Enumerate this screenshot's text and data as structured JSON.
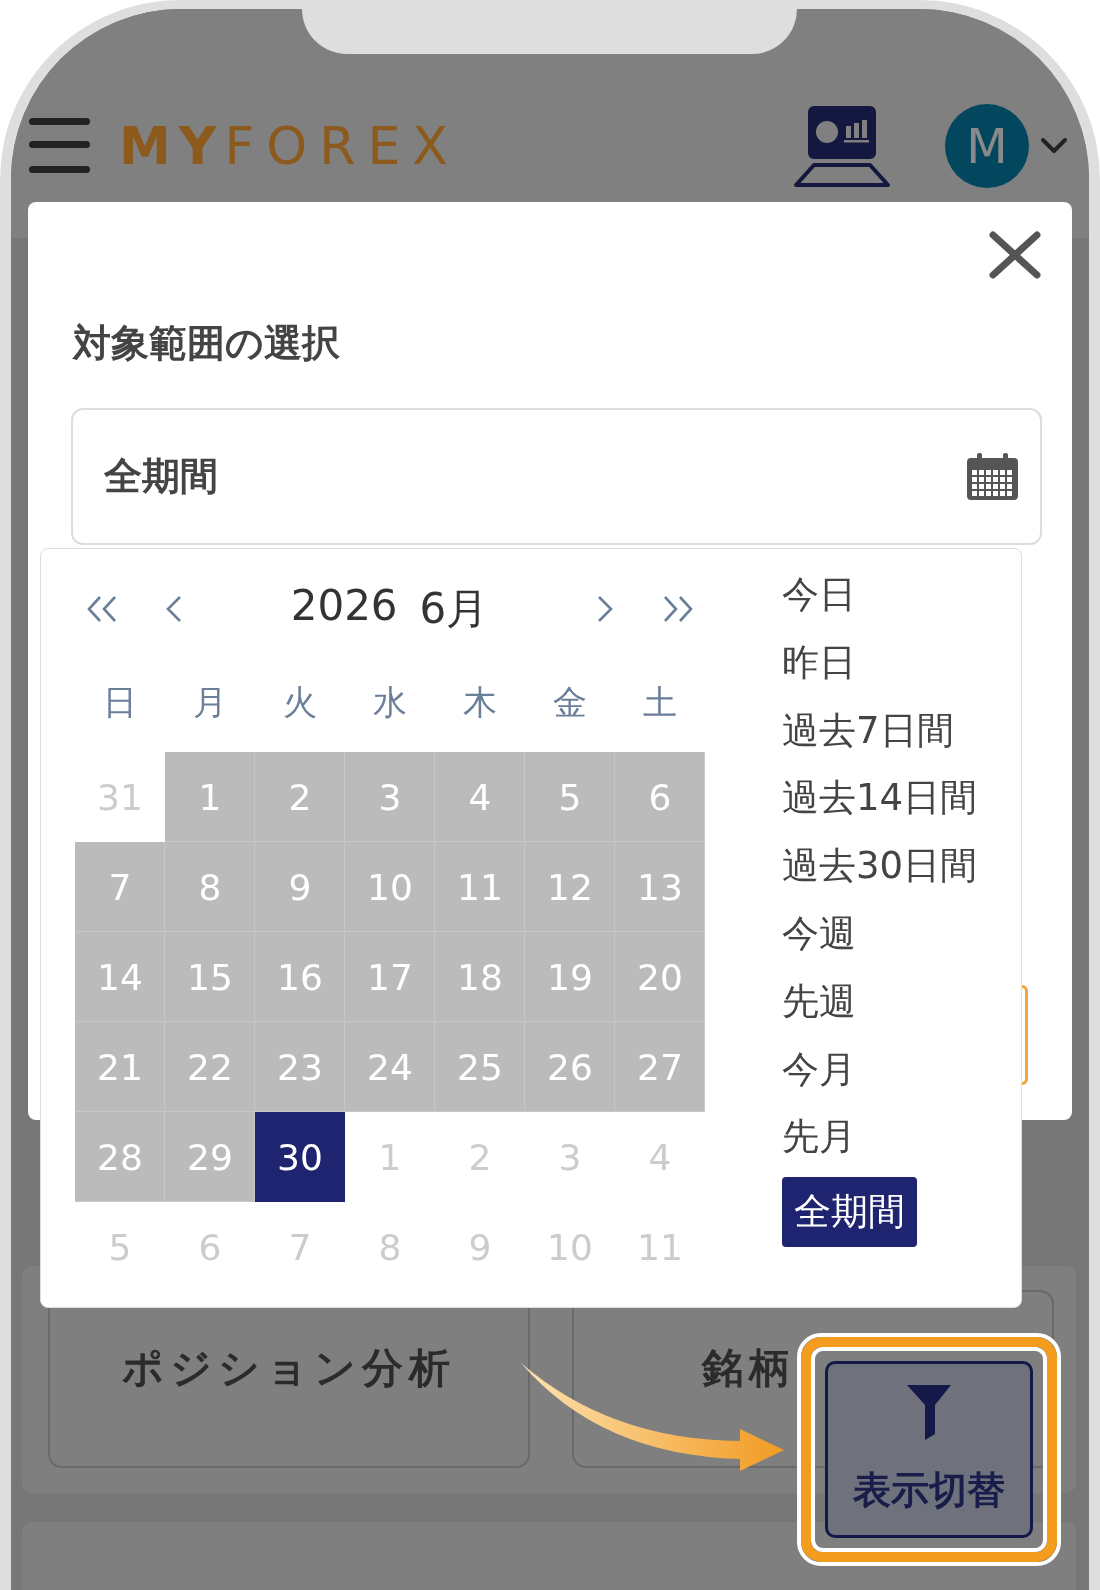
{
  "header": {
    "logo": "**MY**FOREX",
    "avatar_initial": "M"
  },
  "modal": {
    "title": "対象範囲の選択",
    "field": {
      "value": "全期間"
    }
  },
  "calendar": {
    "year": "2026",
    "month": "6月",
    "weekdays": [
      "日",
      "月",
      "火",
      "水",
      "木",
      "金",
      "土"
    ],
    "weeks": [
      [
        {
          "label": "31",
          "muted": true,
          "in_range": false,
          "selected": false
        },
        {
          "label": "1",
          "muted": false,
          "in_range": true,
          "selected": false
        },
        {
          "label": "2",
          "muted": false,
          "in_range": true,
          "selected": false
        },
        {
          "label": "3",
          "muted": false,
          "in_range": true,
          "selected": false
        },
        {
          "label": "4",
          "muted": false,
          "in_range": true,
          "selected": false
        },
        {
          "label": "5",
          "muted": false,
          "in_range": true,
          "selected": false
        },
        {
          "label": "6",
          "muted": false,
          "in_range": true,
          "selected": false
        }
      ],
      [
        {
          "label": "7",
          "muted": false,
          "in_range": true,
          "selected": false
        },
        {
          "label": "8",
          "muted": false,
          "in_range": true,
          "selected": false
        },
        {
          "label": "9",
          "muted": false,
          "in_range": true,
          "selected": false
        },
        {
          "label": "10",
          "muted": false,
          "in_range": true,
          "selected": false
        },
        {
          "label": "11",
          "muted": false,
          "in_range": true,
          "selected": false
        },
        {
          "label": "12",
          "muted": false,
          "in_range": true,
          "selected": false
        },
        {
          "label": "13",
          "muted": false,
          "in_range": true,
          "selected": false
        }
      ],
      [
        {
          "label": "14",
          "muted": false,
          "in_range": true,
          "selected": false
        },
        {
          "label": "15",
          "muted": false,
          "in_range": true,
          "selected": false
        },
        {
          "label": "16",
          "muted": false,
          "in_range": true,
          "selected": false
        },
        {
          "label": "17",
          "muted": false,
          "in_range": true,
          "selected": false
        },
        {
          "label": "18",
          "muted": false,
          "in_range": true,
          "selected": false
        },
        {
          "label": "19",
          "muted": false,
          "in_range": true,
          "selected": false
        },
        {
          "label": "20",
          "muted": false,
          "in_range": true,
          "selected": false
        }
      ],
      [
        {
          "label": "21",
          "muted": false,
          "in_range": true,
          "selected": false
        },
        {
          "label": "22",
          "muted": false,
          "in_range": true,
          "selected": false
        },
        {
          "label": "23",
          "muted": false,
          "in_range": true,
          "selected": false
        },
        {
          "label": "24",
          "muted": false,
          "in_range": true,
          "selected": false
        },
        {
          "label": "25",
          "muted": false,
          "in_range": true,
          "selected": false
        },
        {
          "label": "26",
          "muted": false,
          "in_range": true,
          "selected": false
        },
        {
          "label": "27",
          "muted": false,
          "in_range": true,
          "selected": false
        }
      ],
      [
        {
          "label": "28",
          "muted": false,
          "in_range": true,
          "selected": false
        },
        {
          "label": "29",
          "muted": false,
          "in_range": true,
          "selected": false
        },
        {
          "label": "30",
          "muted": false,
          "in_range": false,
          "selected": true
        },
        {
          "label": "1",
          "muted": true,
          "in_range": false,
          "selected": false
        },
        {
          "label": "2",
          "muted": true,
          "in_range": false,
          "selected": false
        },
        {
          "label": "3",
          "muted": true,
          "in_range": false,
          "selected": false
        },
        {
          "label": "4",
          "muted": true,
          "in_range": false,
          "selected": false
        }
      ],
      [
        {
          "label": "5",
          "muted": true,
          "in_range": false,
          "selected": false
        },
        {
          "label": "6",
          "muted": true,
          "in_range": false,
          "selected": false
        },
        {
          "label": "7",
          "muted": true,
          "in_range": false,
          "selected": false
        },
        {
          "label": "8",
          "muted": true,
          "in_range": false,
          "selected": false
        },
        {
          "label": "9",
          "muted": true,
          "in_range": false,
          "selected": false
        },
        {
          "label": "10",
          "muted": true,
          "in_range": false,
          "selected": false
        },
        {
          "label": "11",
          "muted": true,
          "in_range": false,
          "selected": false
        }
      ]
    ]
  },
  "presets": [
    {
      "label": "今日",
      "selected": false
    },
    {
      "label": "昨日",
      "selected": false
    },
    {
      "label": "過去7日間",
      "selected": false
    },
    {
      "label": "過去14日間",
      "selected": false
    },
    {
      "label": "過去30日間",
      "selected": false
    },
    {
      "label": "今週",
      "selected": false
    },
    {
      "label": "先週",
      "selected": false
    },
    {
      "label": "今月",
      "selected": false
    },
    {
      "label": "先月",
      "selected": false
    },
    {
      "label": "全期間",
      "selected": true
    }
  ],
  "page": {
    "cards": [
      {
        "label": "ポジション分析"
      },
      {
        "label": "銘柄"
      }
    ]
  },
  "callout": {
    "button_label": "表示切替"
  }
}
